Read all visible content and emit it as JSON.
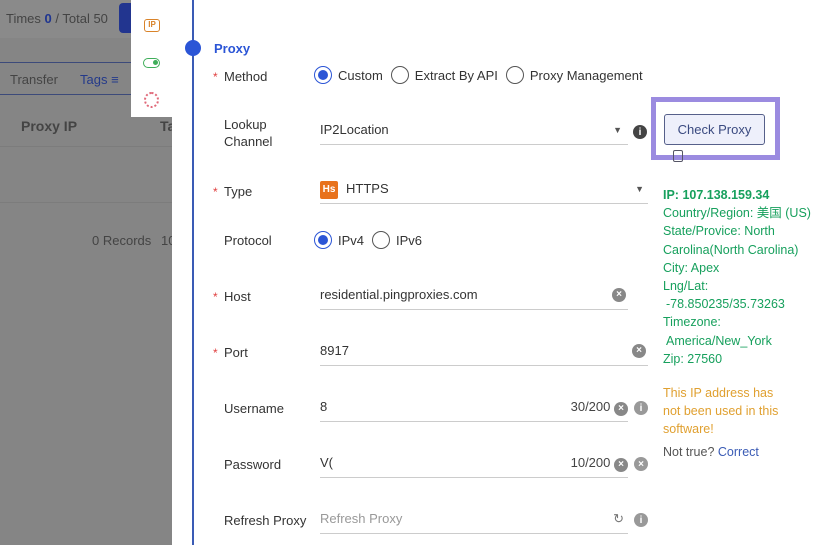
{
  "background": {
    "times_label": "Times",
    "times_value": "0",
    "total_label": "/ Total 50",
    "tab_transfer": "Transfer",
    "tab_tags": "Tags",
    "col_proxy_ip": "Proxy IP",
    "col_tags_partial": "Ta",
    "records": "0 Records",
    "page_partial": "10"
  },
  "section_title": "Proxy",
  "method": {
    "label": "Method",
    "options": [
      "Custom",
      "Extract By API",
      "Proxy Management"
    ],
    "selected": 0
  },
  "lookup": {
    "label_line1": "Lookup",
    "label_line2": "Channel",
    "value": "IP2Location"
  },
  "type": {
    "label": "Type",
    "badge": "Hs",
    "value": "HTTPS"
  },
  "protocol": {
    "label": "Protocol",
    "options": [
      "IPv4",
      "IPv6"
    ],
    "selected": 0
  },
  "host": {
    "label": "Host",
    "value": "residential.pingproxies.com"
  },
  "port": {
    "label": "Port",
    "value": "8917"
  },
  "username": {
    "label": "Username",
    "value": "8",
    "counter": "30/200"
  },
  "password": {
    "label": "Password",
    "value": "V(",
    "counter": "10/200"
  },
  "refresh": {
    "label": "Refresh Proxy",
    "placeholder": "Refresh Proxy"
  },
  "check_button": "Check Proxy",
  "result": {
    "ip": "IP:  107.138.159.34",
    "country": "Country/Region:  美国 (US)",
    "state": "State/Provice:   North Carolina(North Carolina)",
    "city": "City: Apex",
    "lnglat_label": "Lng/Lat:",
    "lnglat": "-78.850235/35.73263",
    "tz_label": "Timezone:",
    "tz": "America/New_York",
    "zip": "Zip:  27560",
    "warning": "This IP address has not been used in this software!",
    "not_true": "Not true?",
    "correct": "Correct"
  },
  "colors": {
    "accent": "#2b55d6",
    "success": "#17a05d",
    "warning": "#e0a030",
    "highlight": "#9b8be0"
  }
}
